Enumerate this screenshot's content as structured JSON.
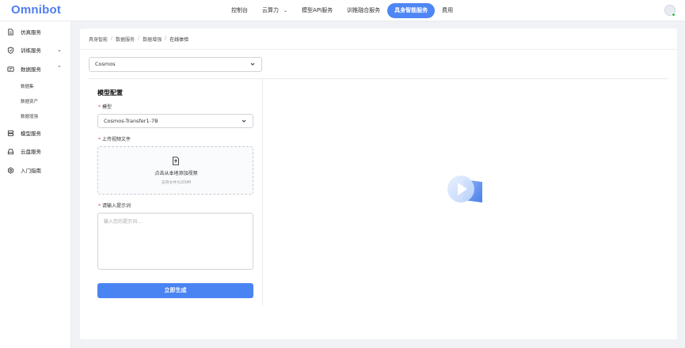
{
  "app": {
    "logo": "Omnibot"
  },
  "topnav": {
    "items": [
      {
        "label": "控制台",
        "dropdown": false,
        "active": false
      },
      {
        "label": "云算力",
        "dropdown": true,
        "active": false
      },
      {
        "label": "模型API服务",
        "dropdown": false,
        "active": false
      },
      {
        "label": "训推融合服务",
        "dropdown": false,
        "active": false
      },
      {
        "label": "具身智能服务",
        "dropdown": false,
        "active": true
      },
      {
        "label": "费用",
        "dropdown": false,
        "active": false
      }
    ]
  },
  "sidebar": {
    "items": [
      {
        "label": "仿真服务",
        "icon": "document-icon"
      },
      {
        "label": "训练服务",
        "icon": "shield-icon",
        "expand": "collapsed"
      },
      {
        "label": "数据服务",
        "icon": "data-icon",
        "expand": "expanded"
      },
      {
        "label": "模型服务",
        "icon": "server-icon"
      },
      {
        "label": "云盘服务",
        "icon": "disk-icon"
      },
      {
        "label": "入门指南",
        "icon": "gear-icon"
      }
    ],
    "data_sub": [
      "数据集",
      "数据资产",
      "数据增强"
    ]
  },
  "breadcrumb": [
    "具身智能",
    "数据服务",
    "数据增强",
    "在线体验"
  ],
  "top_select": {
    "value": "Cosmos"
  },
  "config": {
    "title": "模型配置",
    "model_label": "模型",
    "model_value": "Cosmos-Transfer1-7B",
    "upload_label": "上传视频文件",
    "upload_text": "点击从本地添加视频",
    "upload_hint": "支持文件为200M",
    "prompt_label": "请输入提示词",
    "prompt_placeholder": "输入您的提示词...",
    "generate_label": "立即生成"
  },
  "colors": {
    "accent": "#4a84f2",
    "required": "#e0413a"
  }
}
